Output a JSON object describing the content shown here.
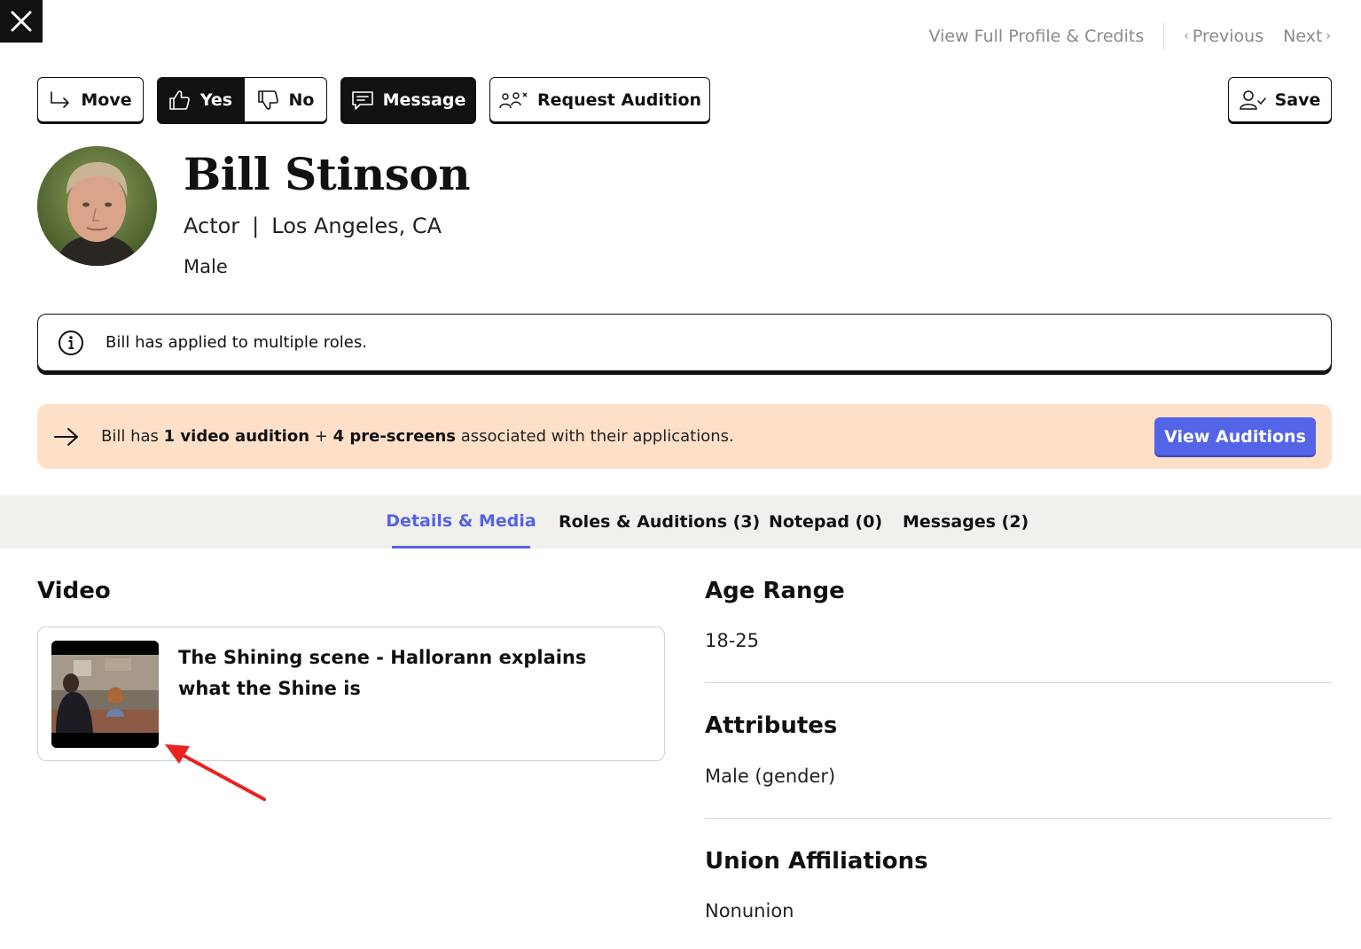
{
  "topnav": {
    "full_profile": "View Full Profile & Credits",
    "previous": "Previous",
    "next": "Next"
  },
  "actions": {
    "move": "Move",
    "yes": "Yes",
    "no": "No",
    "message": "Message",
    "request_audition": "Request Audition",
    "save": "Save"
  },
  "profile": {
    "name": "Bill Stinson",
    "role": "Actor",
    "location": "Los Angeles, CA",
    "gender": "Male"
  },
  "info_banner": {
    "text": "Bill has applied to multiple roles."
  },
  "auditions_banner": {
    "prefix": "Bill has",
    "video_count": "1 video audition",
    "plus": "+",
    "prescreens": "4 pre-screens",
    "suffix": "associated with their applications.",
    "button": "View Auditions",
    "accent_color": "#5464e6",
    "background_color": "#fde0c7"
  },
  "tabs": [
    {
      "label": "Details & Media",
      "active": true
    },
    {
      "label": "Roles & Auditions (3)",
      "active": false
    },
    {
      "label": "Notepad (0)",
      "active": false
    },
    {
      "label": "Messages (2)",
      "active": false
    }
  ],
  "video_section": {
    "title": "Video",
    "items": [
      {
        "title": "The Shining scene - Hallorann explains what the Shine is"
      }
    ]
  },
  "details": {
    "age_range": {
      "label": "Age Range",
      "value": "18-25"
    },
    "attributes": {
      "label": "Attributes",
      "value": "Male (gender)"
    },
    "union": {
      "label": "Union Affiliations",
      "value": "Nonunion"
    }
  }
}
